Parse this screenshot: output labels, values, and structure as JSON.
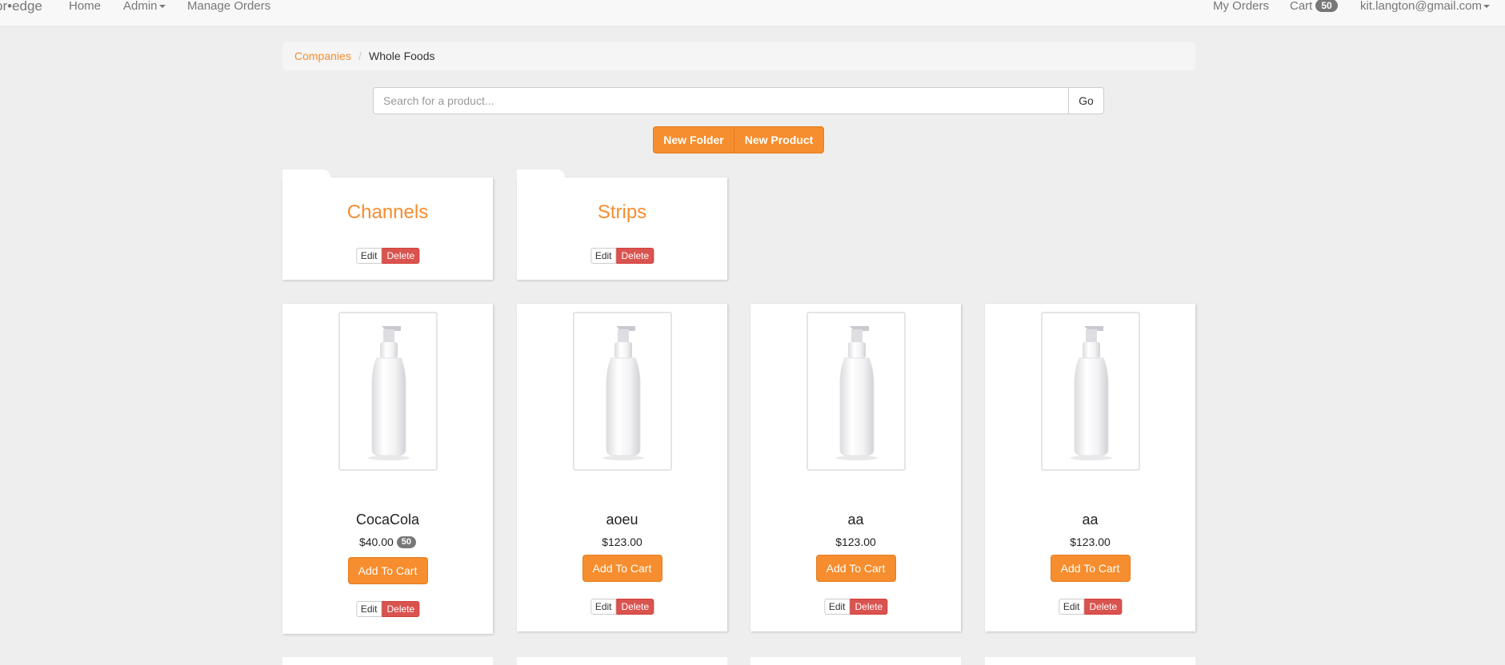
{
  "nav": {
    "brand": "or•edge",
    "home": "Home",
    "admin": "Admin",
    "manage_orders": "Manage Orders",
    "my_orders": "My Orders",
    "cart_label": "Cart",
    "cart_count": "50",
    "user_email": "kit.langton@gmail.com"
  },
  "breadcrumb": {
    "companies": "Companies",
    "separator": "/",
    "current": "Whole Foods"
  },
  "search": {
    "placeholder": "Search for a product...",
    "value": "",
    "go_label": "Go"
  },
  "actions": {
    "new_folder": "New Folder",
    "new_product": "New Product"
  },
  "folders": [
    {
      "title": "Channels",
      "edit": "Edit",
      "delete": "Delete"
    },
    {
      "title": "Strips",
      "edit": "Edit",
      "delete": "Delete"
    }
  ],
  "products": [
    {
      "name": "CocaCola",
      "price": "$40.00",
      "badge": "50",
      "add_to_cart": "Add To Cart",
      "edit": "Edit",
      "delete": "Delete"
    },
    {
      "name": "aoeu",
      "price": "$123.00",
      "add_to_cart": "Add To Cart",
      "edit": "Edit",
      "delete": "Delete"
    },
    {
      "name": "aa",
      "price": "$123.00",
      "add_to_cart": "Add To Cart",
      "edit": "Edit",
      "delete": "Delete"
    },
    {
      "name": "aa",
      "price": "$123.00",
      "add_to_cart": "Add To Cart",
      "edit": "Edit",
      "delete": "Delete"
    }
  ],
  "colors": {
    "accent": "#f68d2e",
    "danger": "#d9534f",
    "background": "#eeeeee",
    "navbar": "#f8f8f8"
  }
}
